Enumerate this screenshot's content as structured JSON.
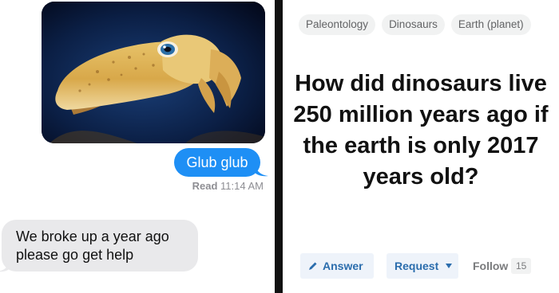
{
  "messages": {
    "image_alt": "cuttlefish photo",
    "sent_text": "Glub glub",
    "read_label": "Read",
    "read_time": "11:14 AM",
    "received_text": "We broke up a year ago please go get help"
  },
  "quora": {
    "topics": [
      "Paleontology",
      "Dinosaurs",
      "Earth (planet)"
    ],
    "question": "How did dinosaurs live 250 million years ago if the earth is only 2017 years old?",
    "answer_label": "Answer",
    "request_label": "Request",
    "follow_label": "Follow",
    "follow_count": "15"
  },
  "colors": {
    "imessage_blue": "#1e8ff5",
    "received_gray": "#e9e9eb",
    "quora_blue": "#2b6dad",
    "divider": "#111111"
  },
  "icons": [
    "pencil-icon",
    "caret-down-icon"
  ]
}
